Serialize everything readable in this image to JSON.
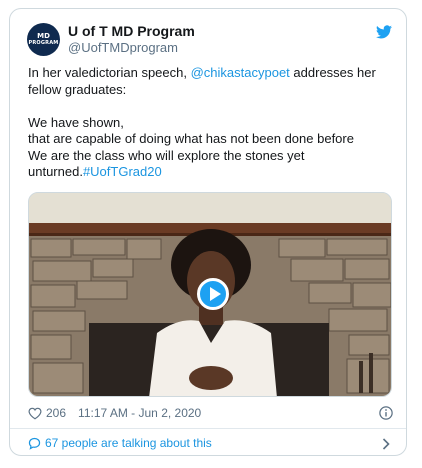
{
  "account": {
    "avatar_line1": "MD",
    "avatar_line2": "PROGRAM",
    "display_name": "U of T MD Program",
    "handle": "@UofTMDprogram"
  },
  "tweet": {
    "intro_before": "In her valedictorian speech, ",
    "mention": "@chikastacypoet",
    "intro_after": " addresses her fellow graduates:",
    "quote_line1": "We have shown,",
    "quote_line2": "that are capable of doing what has not been done before",
    "quote_line3": "We are the class who will explore the stones yet",
    "quote_line4_start": "unturned.",
    "hashtag": "#UofTGrad20"
  },
  "footer": {
    "likes": "206",
    "timestamp": "11:17 AM - Jun 2, 2020",
    "talking": "67 people are talking about this"
  },
  "colors": {
    "link": "#1b95e0",
    "twitter_blue": "#1da1f2",
    "avatar_bg": "#0f2a4f"
  },
  "icons": [
    "twitter-bird-icon",
    "play-icon",
    "heart-icon",
    "info-icon",
    "comment-bubble-icon",
    "chevron-right-icon"
  ]
}
